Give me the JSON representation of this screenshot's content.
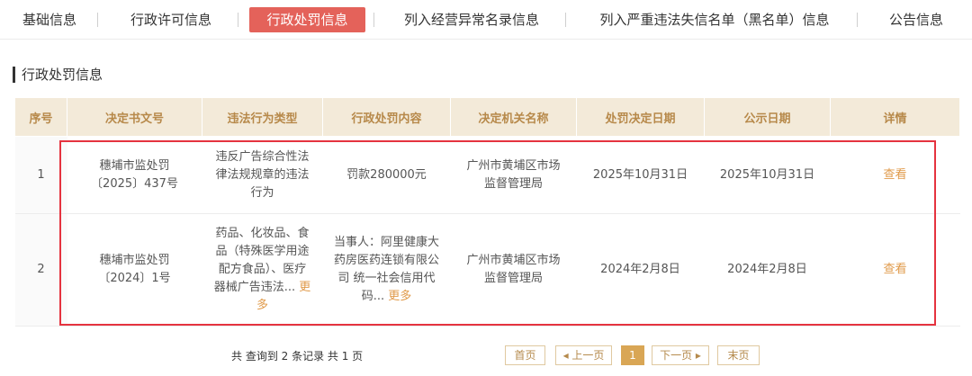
{
  "tabs": [
    {
      "label": "基础信息"
    },
    {
      "label": "行政许可信息"
    },
    {
      "label": "行政处罚信息",
      "active": true
    },
    {
      "label": "列入经营异常名录信息"
    },
    {
      "label": "列入严重违法失信名单（黑名单）信息"
    },
    {
      "label": "公告信息"
    }
  ],
  "section_title": "行政处罚信息",
  "table": {
    "headers": [
      "序号",
      "决定书文号",
      "违法行为类型",
      "行政处罚内容",
      "决定机关名称",
      "处罚决定日期",
      "公示日期",
      "详情"
    ],
    "rows": [
      {
        "index": "1",
        "doc_no": "穗埔市监处罚〔2025〕437号",
        "violation_type": "违反广告综合性法律法规规章的违法行为",
        "penalty": "罚款280000元",
        "authority": "广州市黄埔区市场监督管理局",
        "decision_date": "2025年10月31日",
        "publish_date": "2025年10月31日",
        "detail": "查看"
      },
      {
        "index": "2",
        "doc_no": "穗埔市监处罚〔2024〕1号",
        "violation_type": "药品、化妆品、食品（特殊医学用途配方食品）、医疗器械广告违法...",
        "violation_more": "更多",
        "penalty": "当事人：阿里健康大药房医药连锁有限公司 统一社会信用代码...",
        "penalty_more": "更多",
        "authority": "广州市黄埔区市场监督管理局",
        "decision_date": "2024年2月8日",
        "publish_date": "2024年2月8日",
        "detail": "查看"
      }
    ]
  },
  "summary": "共 查询到 2 条记录 共 1 页",
  "pagination": {
    "first": "首页",
    "prev": "◂ 上一页",
    "current": "1",
    "next": "下一页 ▸",
    "last": "末页"
  },
  "colors": {
    "accent_tab": "#e4625a",
    "header_bg": "#f3ead9",
    "header_text": "#b7894a",
    "link": "#e09a4a",
    "highlight_box": "#e5333f"
  }
}
